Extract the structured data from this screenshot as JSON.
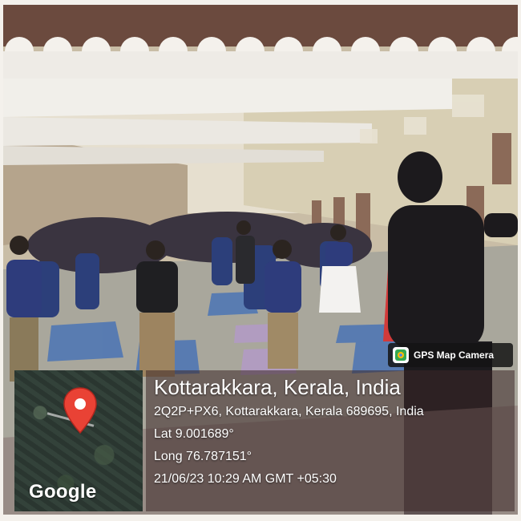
{
  "stamp": {
    "badge_label": "GPS Map Camera",
    "map_logo": "Google",
    "city": "Kottarakkara, Kerala, India",
    "address": "2Q2P+PX6, Kottarakkara, Kerala 689695, India",
    "lat": "Lat 9.001689°",
    "long": "Long 76.787151°",
    "datetime": "21/06/23 10:29 AM GMT +05:30"
  },
  "colors": {
    "pin_red": "#e94235",
    "panel_tint": "#3c2828",
    "roof_brown": "#6b4a3e"
  },
  "icons": {
    "badge_icon": "map-camera-icon",
    "map_pin": "map-pin-icon"
  }
}
